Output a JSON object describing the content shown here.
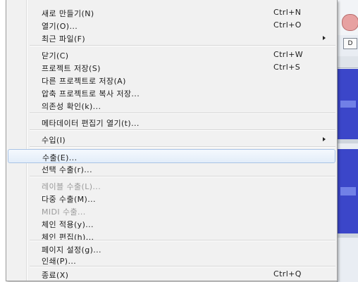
{
  "file_menu": {
    "items": [
      {
        "label": "새로 만들기(N)",
        "shortcut": "Ctrl+N"
      },
      {
        "label": "열기(O)...",
        "shortcut": "Ctrl+O"
      },
      {
        "label": "최근 파일(F)",
        "has_submenu": true
      },
      {
        "label": "닫기(C)",
        "shortcut": "Ctrl+W"
      },
      {
        "label": "프로젝트 저장(S)",
        "shortcut": "Ctrl+S"
      },
      {
        "label": "다른 프로젝트로 저장(A)"
      },
      {
        "label": "압축 프로젝트로 복사 저장..."
      },
      {
        "label": "의존성 확인(k)..."
      },
      {
        "label": "메타데이터 편집기 열기(t)..."
      },
      {
        "label": "수입(I)",
        "has_submenu": true
      },
      {
        "label": "수출(E)...",
        "highlighted": true
      },
      {
        "label": "선택 수출(r)..."
      },
      {
        "label": "레이블 수출(L)...",
        "disabled": true
      },
      {
        "label": "다중 수출(M)..."
      },
      {
        "label": "MIDI 수출...",
        "disabled": true
      },
      {
        "label": "체인 적용(y)..."
      },
      {
        "label": "체인 편집(h)..."
      },
      {
        "label": "페이지 설정(g)..."
      },
      {
        "label": "인쇄(P)..."
      },
      {
        "label": "종료(X)",
        "shortcut": "Ctrl+Q"
      }
    ]
  },
  "background_app": {
    "toolbar_button_text": "D"
  }
}
